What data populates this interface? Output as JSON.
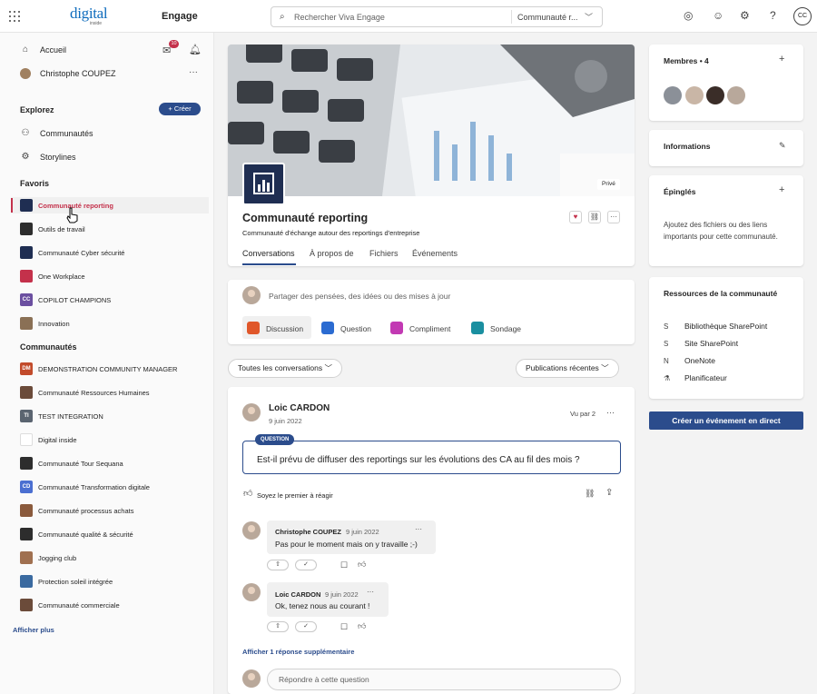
{
  "topbar": {
    "logo_main": "digital",
    "logo_sub": "inside",
    "app_name": "Engage",
    "search_placeholder": "Rechercher Viva Engage",
    "search_scope": "Communauté r...",
    "user_initials": "CC"
  },
  "sidebar": {
    "home": "Accueil",
    "notif_count": "10",
    "user": "Christophe COUPEZ",
    "explore_heading": "Explorez",
    "create_label": "Créer",
    "communities_link": "Communautés",
    "storylines_link": "Storylines",
    "favorites_heading": "Favoris",
    "favorites": [
      {
        "label": "Communauté reporting",
        "color": "#1f2e52"
      },
      {
        "label": "Outils de travail",
        "color": "#2d2d2d"
      },
      {
        "label": "Communauté Cyber sécurité",
        "color": "#1f2e52"
      },
      {
        "label": "One Workplace",
        "color": "#c4314b"
      },
      {
        "label": "COPILOT CHAMPIONS",
        "color": "#6b4fa0",
        "abbr": "CC"
      },
      {
        "label": "Innovation",
        "color": "#8a7055"
      }
    ],
    "communities_heading": "Communautés",
    "communities": [
      {
        "label": "DEMONSTRATION COMMUNITY MANAGER",
        "abbr": "DM",
        "color": "#c24b2b"
      },
      {
        "label": "Communauté Ressources Humaines",
        "color": "#6b4b3a"
      },
      {
        "label": "TEST INTEGRATION",
        "abbr": "TI",
        "color": "#5a6470"
      },
      {
        "label": "Digital inside",
        "color": "#ffffff"
      },
      {
        "label": "Communauté Tour Sequana",
        "color": "#2d2d2d"
      },
      {
        "label": "Communauté Transformation digitale",
        "abbr": "CD",
        "color": "#4b6fd1"
      },
      {
        "label": "Communauté processus achats",
        "color": "#8a5a3c"
      },
      {
        "label": "Communauté qualité & sécurité",
        "color": "#2d2d2d"
      },
      {
        "label": "Jogging club",
        "color": "#a07050"
      },
      {
        "label": "Protection soleil intégrée",
        "color": "#3a6aa0"
      },
      {
        "label": "Communauté commerciale",
        "color": "#6b4b3a"
      }
    ],
    "show_more": "Afficher plus"
  },
  "community": {
    "name": "Communauté reporting",
    "description": "Communauté d'échange autour des reportings d'entreprise",
    "privacy": "Privé",
    "tabs": [
      "Conversations",
      "À propos de",
      "Fichiers",
      "Événements"
    ]
  },
  "composer": {
    "placeholder": "Partager des pensées, des idées ou des mises à jour",
    "types": [
      "Discussion",
      "Question",
      "Compliment",
      "Sondage"
    ],
    "type_colors": [
      "#e0572a",
      "#2b6bd1",
      "#c239b3",
      "#1a8fa0"
    ]
  },
  "filters": {
    "left": "Toutes les conversations",
    "right": "Publications récentes"
  },
  "post": {
    "author": "Loic CARDON",
    "date": "9 juin 2022",
    "seen": "Vu par 2",
    "badge": "QUESTION",
    "question": "Est-il prévu de diffuser des reportings sur les évolutions des CA au fil des mois ?",
    "like_prompt": "Soyez le premier à réagir",
    "replies": [
      {
        "author": "Christophe COUPEZ",
        "date": "9 juin 2022",
        "text": "Pas pour le moment mais on y travaille ;-)"
      },
      {
        "author": "Loic CARDON",
        "date": "9 juin 2022",
        "text": "Ok, tenez nous au courant !"
      }
    ],
    "more_replies": "Afficher 1 réponse supplémentaire",
    "reply_placeholder": "Répondre à cette question"
  },
  "right": {
    "members_label": "Membres",
    "members_count": "4",
    "info_label": "Informations",
    "pinned_label": "Épinglés",
    "pinned_text": "Ajoutez des fichiers ou des liens importants pour cette communauté.",
    "resources_label": "Ressources de la communauté",
    "resources": [
      "Bibliothèque SharePoint",
      "Site SharePoint",
      "OneNote",
      "Planificateur"
    ],
    "live_event_button": "Créer un événement en direct"
  }
}
